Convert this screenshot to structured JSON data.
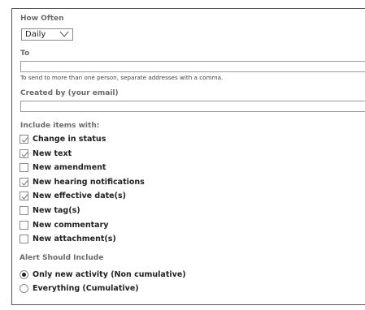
{
  "how_often": {
    "label": "How Often",
    "selected": "Daily"
  },
  "to": {
    "label": "To",
    "value": "",
    "hint": "To send to more than one person, separate addresses with a comma."
  },
  "created_by": {
    "label": "Created by (your email)",
    "value": ""
  },
  "include": {
    "label": "Include items with:",
    "items": [
      {
        "label": "Change in status",
        "checked": true
      },
      {
        "label": "New text",
        "checked": true
      },
      {
        "label": "New amendment",
        "checked": false
      },
      {
        "label": "New hearing notifications",
        "checked": true
      },
      {
        "label": "New effective date(s)",
        "checked": true
      },
      {
        "label": "New tag(s)",
        "checked": false
      },
      {
        "label": "New commentary",
        "checked": false
      },
      {
        "label": "New attachment(s)",
        "checked": false
      }
    ]
  },
  "alert": {
    "label": "Alert Should Include",
    "options": [
      {
        "label": "Only new activity (Non cumulative)",
        "selected": true
      },
      {
        "label": "Everything (Cumulative)",
        "selected": false
      }
    ]
  }
}
